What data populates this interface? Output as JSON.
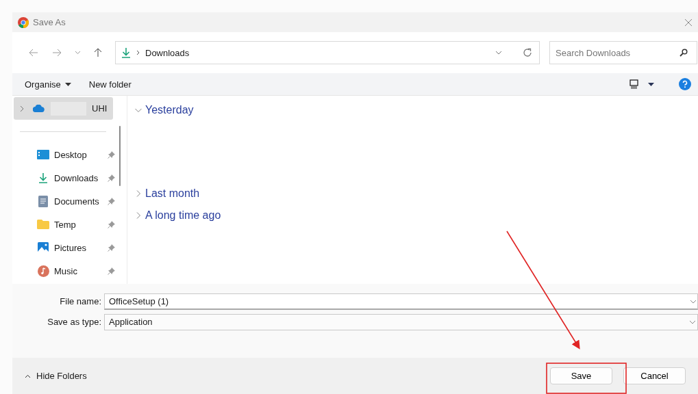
{
  "window": {
    "title": "Save As"
  },
  "address": {
    "location": "Downloads"
  },
  "search": {
    "placeholder": "Search Downloads"
  },
  "toolbar": {
    "organise": "Organise",
    "new_folder": "New folder"
  },
  "sidebar": {
    "account": {
      "label": "UHI",
      "selected": true,
      "expanded": false
    },
    "items": [
      {
        "label": "Desktop",
        "kind": "desktop"
      },
      {
        "label": "Downloads",
        "kind": "downloads"
      },
      {
        "label": "Documents",
        "kind": "documents"
      },
      {
        "label": "Temp",
        "kind": "folder"
      },
      {
        "label": "Pictures",
        "kind": "pictures"
      },
      {
        "label": "Music",
        "kind": "music"
      }
    ]
  },
  "groups": [
    {
      "label": "Yesterday",
      "expanded": true
    },
    {
      "label": "Last month",
      "expanded": false
    },
    {
      "label": "A long time ago",
      "expanded": false
    }
  ],
  "file_name": {
    "label": "File name:",
    "value": "OfficeSetup (1)"
  },
  "save_type": {
    "label": "Save as type:",
    "value": "Application"
  },
  "hide_folders": "Hide Folders",
  "buttons": [
    {
      "label": "Save",
      "highlighted": true
    },
    {
      "label": "Cancel",
      "highlighted": false
    }
  ]
}
